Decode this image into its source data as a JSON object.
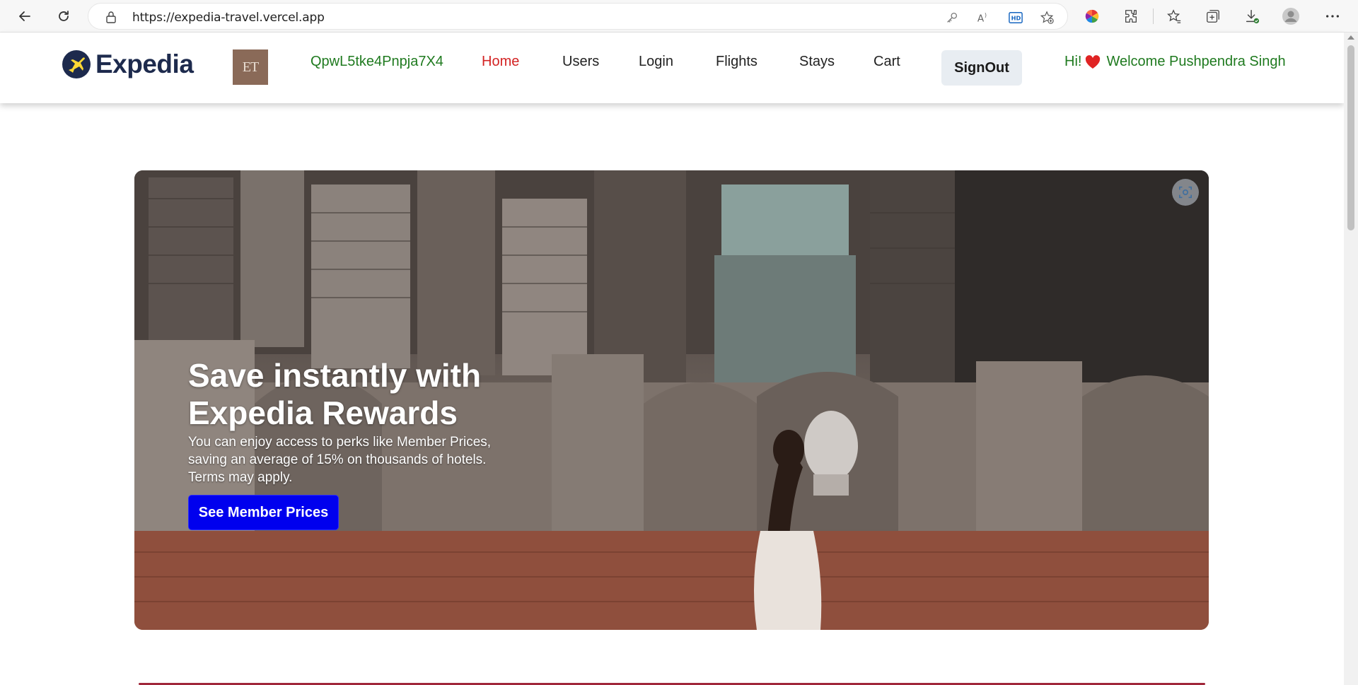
{
  "browser": {
    "url": "https://expedia-travel.vercel.app"
  },
  "header": {
    "logo_text": "Expedia",
    "avatar_initials": "ET",
    "nav": {
      "token": "QpwL5tke4Pnpja7X4",
      "home": "Home",
      "users": "Users",
      "login": "Login",
      "flights": "Flights",
      "stays": "Stays",
      "cart": "Cart"
    },
    "signout_label": "SignOut",
    "welcome_prefix": "Hi!",
    "welcome_text": "Welcome Pushpendra Singh"
  },
  "hero": {
    "title": "Save instantly with Expedia Rewards",
    "description": "You can enjoy access to perks like Member Prices, saving an average of 15% on thousands of hotels. Terms may apply.",
    "cta_label": "See Member Prices"
  },
  "colors": {
    "brand_navy": "#1d2a4d",
    "brand_yellow": "#fdd835",
    "active_nav": "#d32323",
    "token_green": "#1f7a1f",
    "cta_blue": "#0000ee"
  }
}
